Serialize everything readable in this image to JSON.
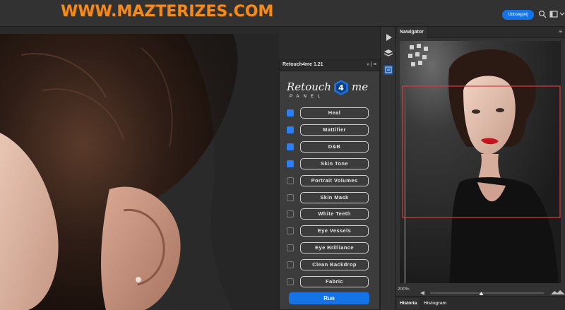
{
  "topbar": {
    "watermark": "WWW.MAZTERIZES.COM",
    "share_label": "Udostępnij",
    "icons": [
      "search-icon",
      "workspace-icon",
      "window-menu-icon"
    ]
  },
  "panel": {
    "title": "Retouch4me 1.21",
    "controls": "»  |  ≡",
    "logo_word_left": "Retouch",
    "logo_word_right": "me",
    "logo_badge_char": "4",
    "logo_sub": "PANEL",
    "items": [
      {
        "label": "Heal",
        "checked": true
      },
      {
        "label": "Mattifier",
        "checked": true
      },
      {
        "label": "D&B",
        "checked": true
      },
      {
        "label": "Skin Tone",
        "checked": true
      },
      {
        "label": "Portrait Volumes",
        "checked": false
      },
      {
        "label": "Skin Mask",
        "checked": false
      },
      {
        "label": "White Teeth",
        "checked": false
      },
      {
        "label": "Eye Vessels",
        "checked": false
      },
      {
        "label": "Eye Brilliance",
        "checked": false
      },
      {
        "label": "Clean Backdrop",
        "checked": false
      },
      {
        "label": "Fabric",
        "checked": false
      }
    ],
    "run_label": "Run"
  },
  "iconcol": {
    "icons": [
      "play-icon",
      "layers-icon",
      "plugin-icon"
    ]
  },
  "navigator": {
    "tab_label": "Nawigator",
    "menu_icon": "panel-menu-icon",
    "zoom_value": "200%",
    "zoom_level": 0.45
  },
  "bottom_tabs": {
    "history": "Historia",
    "histogram": "Histogram"
  },
  "colors": {
    "accent": "#1473e6",
    "watermark": "#f18b1c",
    "checkbox_on": "#2d7ff9",
    "nav_frame": "#e03a3a"
  }
}
